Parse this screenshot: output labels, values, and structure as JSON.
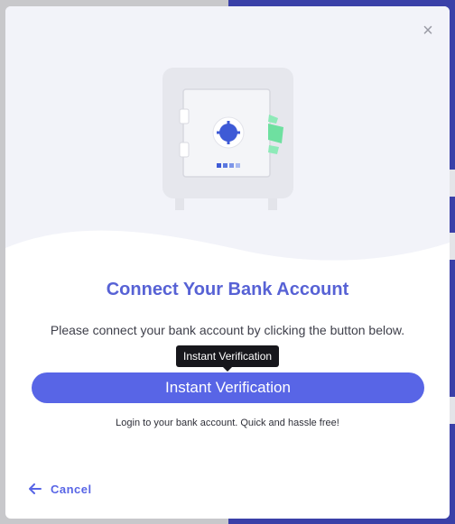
{
  "modal": {
    "title": "Connect Your Bank Account",
    "description": "Please connect your bank account by clicking the button below.",
    "tooltip": "Instant Verification",
    "primary_button": "Instant Verification",
    "subtext": "Login to your bank account. Quick and hassle free!",
    "cancel_label": "Cancel",
    "close_symbol": "×"
  },
  "icons": {
    "close": "close-icon",
    "back": "arrow-left-icon",
    "illustration": "bank-safe-icon"
  },
  "colors": {
    "accent": "#5865e6",
    "title": "#5762d5",
    "backdrop_right": "#3a40a8",
    "tooltip_bg": "#17171c",
    "money_green": "#6ee0a0"
  }
}
